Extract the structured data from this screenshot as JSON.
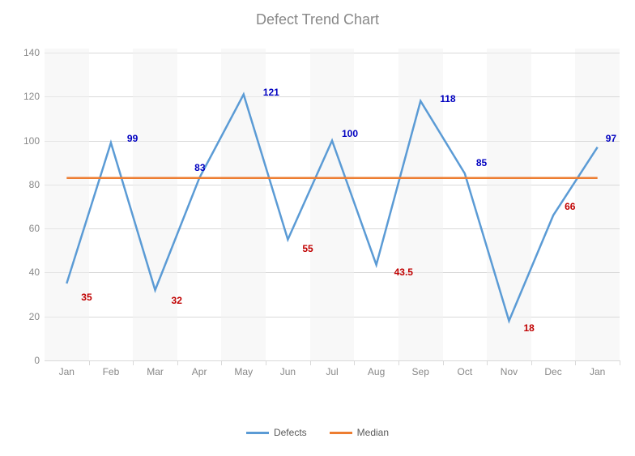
{
  "chart_data": {
    "type": "line",
    "title": "Defect Trend Chart",
    "categories": [
      "Jan",
      "Feb",
      "Mar",
      "Apr",
      "May",
      "Jun",
      "Jul",
      "Aug",
      "Sep",
      "Oct",
      "Nov",
      "Dec",
      "Jan"
    ],
    "series": [
      {
        "name": "Defects",
        "color": "#5b9bd5",
        "values": [
          35,
          99,
          32,
          83,
          121,
          55,
          100,
          43.5,
          118,
          85,
          18,
          66,
          97
        ]
      },
      {
        "name": "Median",
        "color": "#ed7d31",
        "values": [
          83,
          83,
          83,
          83,
          83,
          83,
          83,
          83,
          83,
          83,
          83,
          83,
          83
        ]
      }
    ],
    "ylim": [
      0,
      140
    ],
    "yticks": [
      0,
      20,
      40,
      60,
      80,
      100,
      120,
      140
    ],
    "data_labels": [
      {
        "text": "35",
        "color": "#c00000",
        "x": 0,
        "y": 35,
        "dy": 16,
        "dx": 18
      },
      {
        "text": "99",
        "color": "#0000c0",
        "x": 1,
        "y": 99,
        "dy": -6,
        "dx": 20
      },
      {
        "text": "32",
        "color": "#c00000",
        "x": 2,
        "y": 32,
        "dy": 12,
        "dx": 20
      },
      {
        "text": "83",
        "color": "#0000c0",
        "x": 3,
        "y": 83,
        "dy": -14,
        "dx": -6
      },
      {
        "text": "121",
        "color": "#0000c0",
        "x": 4,
        "y": 121,
        "dy": -4,
        "dx": 24
      },
      {
        "text": "55",
        "color": "#c00000",
        "x": 5,
        "y": 55,
        "dy": 10,
        "dx": 18
      },
      {
        "text": "100",
        "color": "#0000c0",
        "x": 6,
        "y": 100,
        "dy": -10,
        "dx": 12
      },
      {
        "text": "43.5",
        "color": "#c00000",
        "x": 7,
        "y": 43.5,
        "dy": 8,
        "dx": 22
      },
      {
        "text": "118",
        "color": "#0000c0",
        "x": 8,
        "y": 118,
        "dy": -4,
        "dx": 24
      },
      {
        "text": "85",
        "color": "#0000c0",
        "x": 9,
        "y": 85,
        "dy": -14,
        "dx": 14
      },
      {
        "text": "18",
        "color": "#c00000",
        "x": 10,
        "y": 18,
        "dy": 8,
        "dx": 18
      },
      {
        "text": "66",
        "color": "#c00000",
        "x": 11,
        "y": 66,
        "dy": -12,
        "dx": 14
      },
      {
        "text": "97",
        "color": "#0000c0",
        "x": 12,
        "y": 97,
        "dy": -12,
        "dx": 10
      }
    ],
    "legend": [
      {
        "label": "Defects",
        "color": "#5b9bd5"
      },
      {
        "label": "Median",
        "color": "#ed7d31"
      }
    ]
  }
}
